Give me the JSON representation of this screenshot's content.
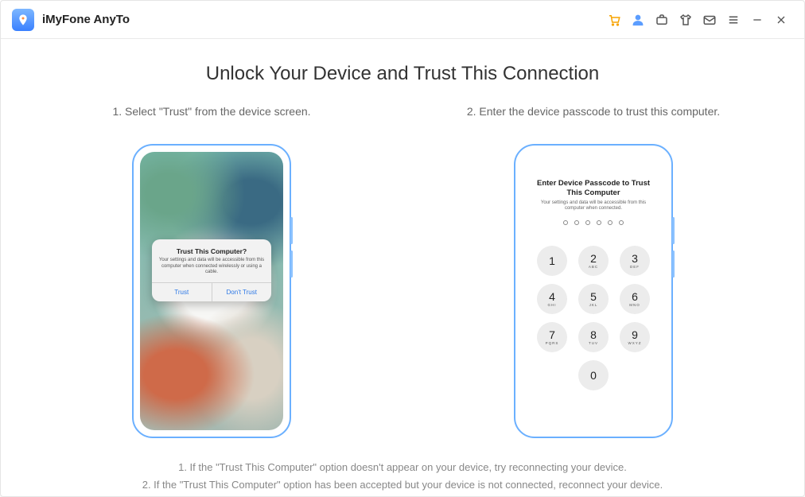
{
  "header": {
    "app_title": "iMyFone AnyTo"
  },
  "main": {
    "title": "Unlock Your Device and Trust This Connection",
    "step1": "1. Select \"Trust\" from the device screen.",
    "step2": "2. Enter the device passcode to trust this computer.",
    "alert": {
      "title": "Trust This Computer?",
      "message": "Your settings and data will be accessible from this computer when connected wirelessly or using a cable.",
      "trust": "Trust",
      "dont_trust": "Don't Trust"
    },
    "passcode": {
      "title": "Enter Device Passcode to Trust This Computer",
      "subtitle": "Your settings and data will be accessible from this computer when connected."
    },
    "keys": {
      "k1": "1",
      "k2": "2",
      "k2l": "ABC",
      "k3": "3",
      "k3l": "DEF",
      "k4": "4",
      "k4l": "GHI",
      "k5": "5",
      "k5l": "JKL",
      "k6": "6",
      "k6l": "MNO",
      "k7": "7",
      "k7l": "PQRS",
      "k8": "8",
      "k8l": "TUV",
      "k9": "9",
      "k9l": "WXYZ",
      "k0": "0"
    },
    "note1": "1. If the \"Trust This Computer\" option doesn't appear on your device, try reconnecting your device.",
    "note2": "2. If the \"Trust This Computer\" option has been accepted but your device is not connected, reconnect your device."
  }
}
